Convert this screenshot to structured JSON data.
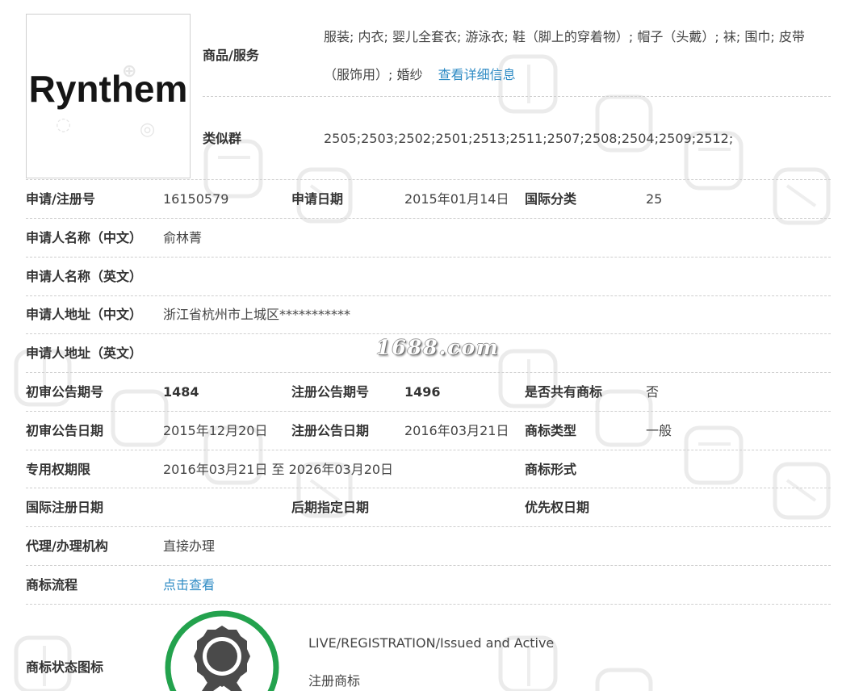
{
  "trademark": {
    "logo_text": "Rynthem",
    "goods_label": "商品/服务",
    "goods_text_line1": "服装; 内衣; 婴儿全套衣; 游泳衣; 鞋（脚上的穿着物）; 帽子（头戴）; 袜; 围巾; 皮带",
    "goods_text_line2": "（服饰用）; 婚纱",
    "goods_detail_link": "查看详细信息",
    "similar_group_label": "类似群",
    "similar_group_value": "2505;2503;2502;2501;2513;2511;2507;2508;2504;2509;2512;"
  },
  "fields": {
    "reg_no_label": "申请/注册号",
    "reg_no": "16150579",
    "apply_date_label": "申请日期",
    "apply_date": "2015年01月14日",
    "intl_class_label": "国际分类",
    "intl_class": "25",
    "applicant_cn_label": "申请人名称（中文）",
    "applicant_cn": "俞林菁",
    "applicant_en_label": "申请人名称（英文）",
    "applicant_en": "",
    "address_cn_label": "申请人地址（中文）",
    "address_cn": "浙江省杭州市上城区***********",
    "address_en_label": "申请人地址（英文）",
    "address_en": "",
    "prelim_issue_label": "初审公告期号",
    "prelim_issue": "1484",
    "reg_issue_label": "注册公告期号",
    "reg_issue": "1496",
    "shared_label": "是否共有商标",
    "shared": "否",
    "prelim_date_label": "初审公告日期",
    "prelim_date": "2015年12月20日",
    "reg_date_label": "注册公告日期",
    "reg_date": "2016年03月21日",
    "tm_type_label": "商标类型",
    "tm_type": "一般",
    "exclusive_period_label": "专用权期限",
    "exclusive_period": "2016年03月21日 至 2026年03月20日",
    "tm_form_label": "商标形式",
    "tm_form": "",
    "intl_reg_date_label": "国际注册日期",
    "intl_reg_date": "",
    "later_date_label": "后期指定日期",
    "later_date": "",
    "priority_date_label": "优先权日期",
    "priority_date": "",
    "agent_label": "代理/办理机构",
    "agent": "直接办理",
    "process_label": "商标流程",
    "process_link": "点击查看",
    "status_icon_label": "商标状态图标",
    "status_en": "LIVE/REGISTRATION/Issued and Active",
    "status_cn": "注册商标"
  },
  "watermark": {
    "site": "1688.com",
    "chars": [
      "中",
      "国",
      "商",
      "标"
    ]
  },
  "colors": {
    "link": "#2e8bc4",
    "status_ring": "#23a24d",
    "status_medal": "#4a4a4a",
    "divider": "#cfcfcf"
  }
}
